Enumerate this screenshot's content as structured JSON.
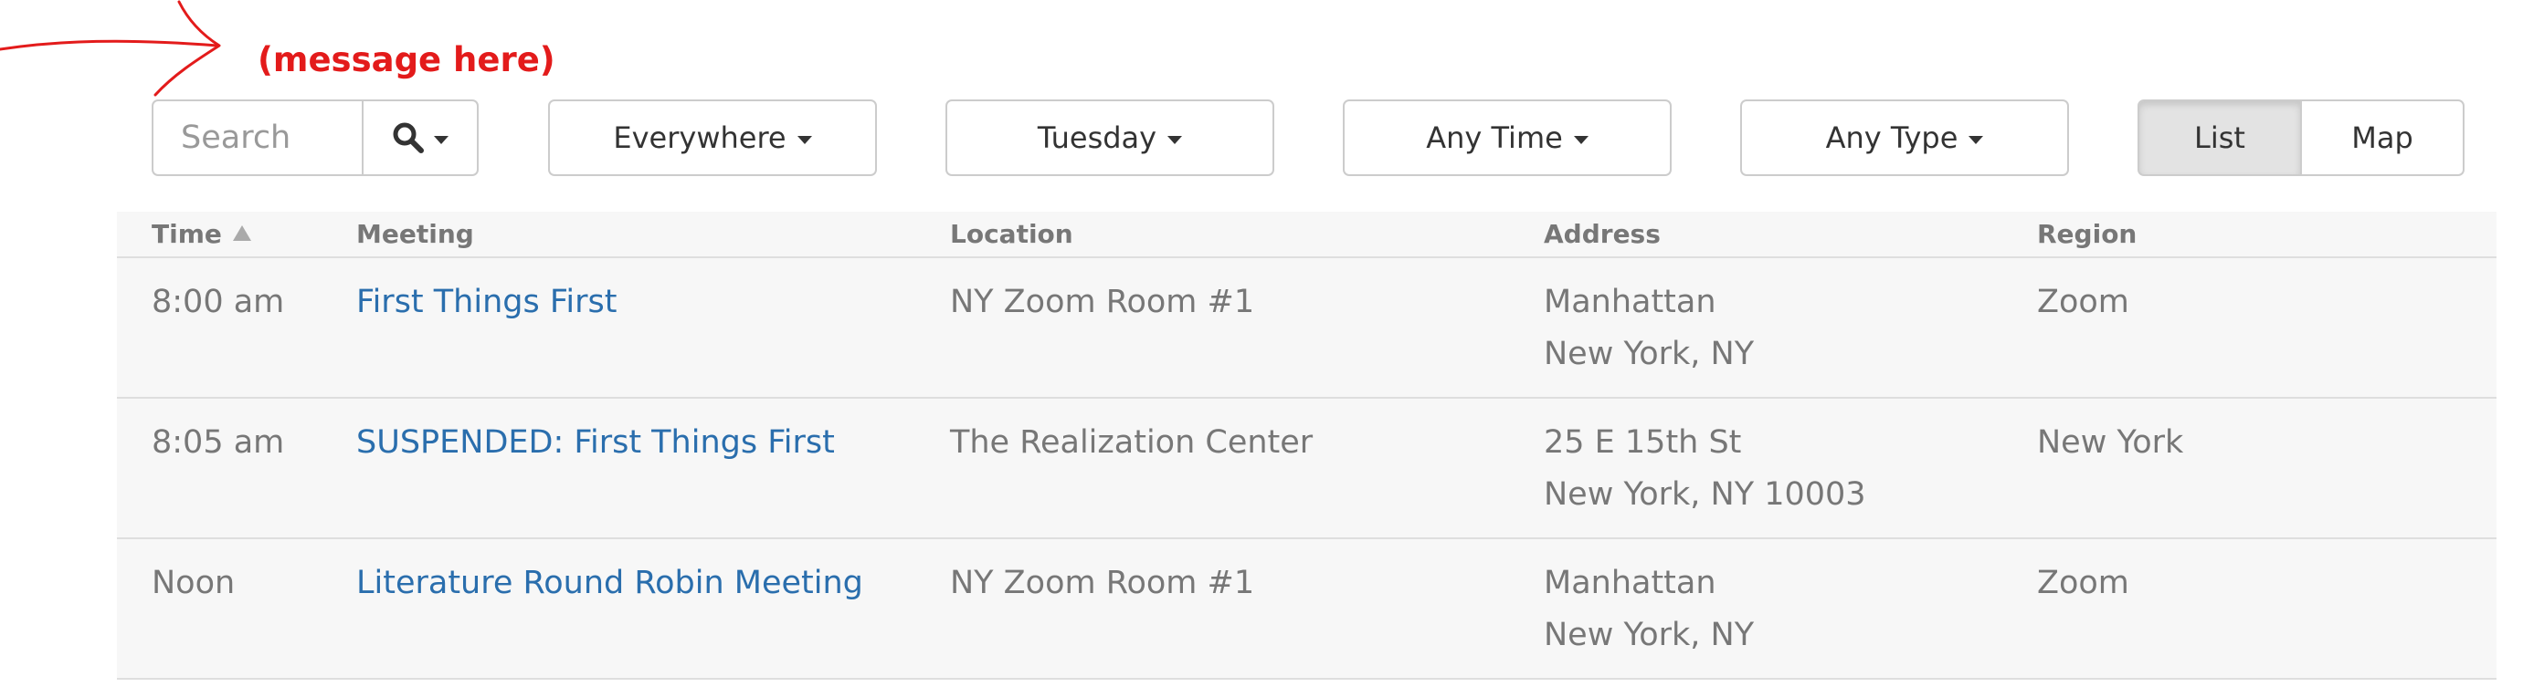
{
  "annotation": {
    "text": "(message here)",
    "color": "#e31b1b"
  },
  "filters": {
    "search_placeholder": "Search",
    "search_icon": "search-icon",
    "region": "Everywhere",
    "day": "Tuesday",
    "time": "Any Time",
    "type": "Any Type"
  },
  "view_toggle": {
    "list": "List",
    "map": "Map",
    "active": "List"
  },
  "table": {
    "headers": {
      "time": "Time",
      "meeting": "Meeting",
      "location": "Location",
      "address": "Address",
      "region": "Region"
    },
    "sorted_by": "Time",
    "rows": [
      {
        "time": "8:00 am",
        "meeting": "First Things First",
        "location": "NY Zoom Room #1",
        "address_line1": "Manhattan",
        "address_line2": "New York, NY",
        "region": "Zoom"
      },
      {
        "time": "8:05 am",
        "meeting": "SUSPENDED: First Things First",
        "location": "The Realization Center",
        "address_line1": "25 E 15th St",
        "address_line2": "New York, NY 10003",
        "region": "New York"
      },
      {
        "time": "Noon",
        "meeting": "Literature Round Robin Meeting",
        "location": "NY Zoom Room #1",
        "address_line1": "Manhattan",
        "address_line2": "New York, NY",
        "region": "Zoom"
      }
    ]
  },
  "colors": {
    "link": "#2a6ead",
    "text_muted": "#777777",
    "row_bg": "#f7f7f7",
    "border": "#cccccc"
  }
}
